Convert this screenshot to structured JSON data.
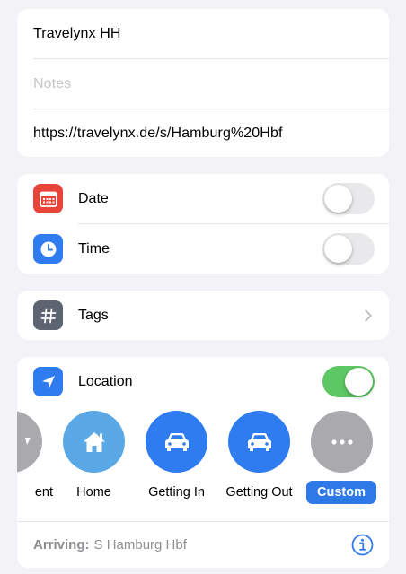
{
  "details": {
    "title": "Travelynx HH",
    "notes_placeholder": "Notes",
    "url": "https://travelynx.de/s/Hamburg%20Hbf"
  },
  "reminders": {
    "date_label": "Date",
    "date_enabled": false,
    "time_label": "Time",
    "time_enabled": false
  },
  "tags": {
    "label": "Tags"
  },
  "location": {
    "label": "Location",
    "enabled": true,
    "options": [
      {
        "label": "ent",
        "icon": "partial-icon",
        "color": "#a9a9ae"
      },
      {
        "label": "Home",
        "icon": "house-icon",
        "color": "#5aa9e6"
      },
      {
        "label": "Getting In",
        "icon": "car-icon",
        "color": "#2f7bf0"
      },
      {
        "label": "Getting Out",
        "icon": "car-icon",
        "color": "#2f7bf0"
      },
      {
        "label": "Custom",
        "icon": "ellipsis-icon",
        "color": "#a9a9ae",
        "selected": true
      }
    ],
    "arriving_prefix": "Arriving:",
    "arriving_value": "S Hamburg Hbf"
  },
  "colors": {
    "accent": "#2e78e8",
    "toggle_on": "#5cc763",
    "date_icon": "#e9443a",
    "time_icon": "#2f7bf0",
    "tags_icon": "#5b6470"
  }
}
